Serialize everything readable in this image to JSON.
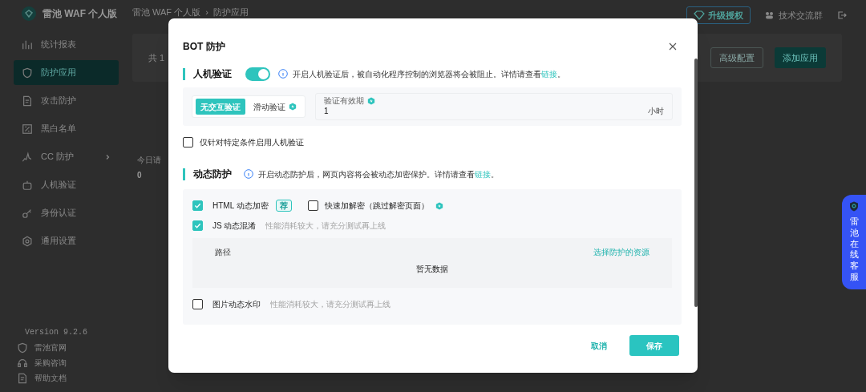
{
  "app": {
    "name": "雷池 WAF 个人版"
  },
  "breadcrumb": {
    "items": [
      {
        "label": "雷池 WAF 个人版"
      },
      {
        "label": "防护应用"
      }
    ],
    "separator": "›"
  },
  "header_actions": [
    {
      "kind": "upgrade",
      "label": "升级授权"
    },
    {
      "kind": "group",
      "label": "技术交流群"
    },
    {
      "kind": "logout"
    }
  ],
  "sidebar": {
    "items": [
      {
        "label": "统计报表",
        "selected": false,
        "expandable": false
      },
      {
        "label": "防护应用",
        "selected": true,
        "expandable": false
      },
      {
        "label": "攻击防护",
        "selected": false,
        "expandable": false
      },
      {
        "label": "黑白名单",
        "selected": false,
        "expandable": false
      },
      {
        "label": "CC 防护",
        "selected": false,
        "expandable": true
      },
      {
        "label": "人机验证",
        "selected": false,
        "expandable": false
      },
      {
        "label": "身份认证",
        "selected": false,
        "expandable": false
      },
      {
        "label": "通用设置",
        "selected": false,
        "expandable": false
      }
    ],
    "version": "Version 9.2.6",
    "links": [
      {
        "label": "雷池官网"
      },
      {
        "label": "采购咨询"
      },
      {
        "label": "帮助文档"
      }
    ]
  },
  "main": {
    "count_text": "共 1",
    "buttons": [
      {
        "label": "高级配置",
        "primary": false
      },
      {
        "label": "添加应用",
        "primary": true
      }
    ],
    "stat_label": "今日请",
    "stat_value": "0"
  },
  "dialog": {
    "title": "BOT 防护",
    "captcha": {
      "title": "人机验证",
      "on": true,
      "text_before": "开启人机验证后，被自动化程序控制的浏览器将会被阻止。详情请查看",
      "link": "链接",
      "text_after": "。",
      "modes": [
        {
          "label": "无交互验证",
          "selected": true,
          "pro": false
        },
        {
          "label": "滑动验证",
          "selected": false,
          "pro": true
        }
      ],
      "validity": {
        "label": "验证有效期",
        "value": "1",
        "unit": "小时"
      },
      "conditional": {
        "label": "仅针对特定条件启用人机验证",
        "checked": false
      }
    },
    "dynamic": {
      "title": "动态防护",
      "text_before": "开启动态防护后，网页内容将会被动态加密保护。详情请查看",
      "link": "链接",
      "text_after": "。",
      "html": {
        "label": "HTML 动态加密",
        "checked": true,
        "badge": "荐"
      },
      "fast": {
        "label": "快速加解密（跳过解密页面）",
        "checked": false
      },
      "js": {
        "label": "JS 动态混淆",
        "checked": true,
        "hint": "性能消耗较大，请充分测试再上线"
      },
      "table": {
        "column": "路径",
        "action": "选择防护的资源",
        "empty": "暂无数据"
      },
      "image": {
        "label": "图片动态水印",
        "checked": false,
        "hint": "性能消耗较大，请充分测试再上线"
      }
    },
    "cancel": "取消",
    "save": "保存"
  },
  "support": {
    "label": "雷池在线客服"
  }
}
